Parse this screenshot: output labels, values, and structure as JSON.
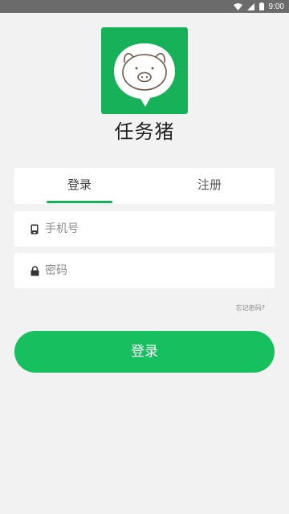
{
  "status_bar": {
    "time": "9:00",
    "icons": [
      "wifi-icon",
      "signal-icon",
      "battery-icon"
    ]
  },
  "app": {
    "name": "任务猪",
    "logo_icon": "pig-chat-bubble-icon",
    "brand_color": "#17b15a"
  },
  "tabs": [
    {
      "label": "登录",
      "selected": true
    },
    {
      "label": "注册",
      "selected": false
    }
  ],
  "form": {
    "phone": {
      "placeholder": "手机号",
      "value": "",
      "icon": "phone-icon"
    },
    "password": {
      "placeholder": "密码",
      "value": "",
      "icon": "lock-icon"
    },
    "forgot_label": "忘记密码?",
    "submit_label": "登录"
  },
  "colors": {
    "accent": "#17c05f",
    "background": "#f2f2f2",
    "status_bar": "#6b6b6b"
  }
}
